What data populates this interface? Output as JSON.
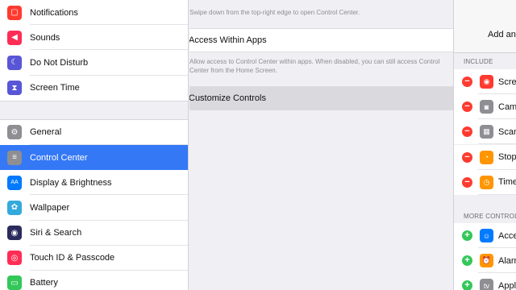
{
  "sidebar": {
    "group1": [
      {
        "label": "Notifications",
        "icon": "notifications-icon",
        "color": "#ff3b30",
        "glyph": "▢"
      },
      {
        "label": "Sounds",
        "icon": "speaker-icon",
        "color": "#ff2d55",
        "glyph": "◀"
      },
      {
        "label": "Do Not Disturb",
        "icon": "moon-icon",
        "color": "#5856d6",
        "glyph": "☾"
      },
      {
        "label": "Screen Time",
        "icon": "hourglass-icon",
        "color": "#5856d6",
        "glyph": "⧗"
      }
    ],
    "group2": [
      {
        "label": "General",
        "icon": "gear-icon",
        "color": "#8e8e93",
        "glyph": "⚙"
      },
      {
        "label": "Control Center",
        "icon": "toggles-icon",
        "color": "#8e8e93",
        "glyph": "≡",
        "selected": true
      },
      {
        "label": "Display & Brightness",
        "icon": "text-size-icon",
        "color": "#007aff",
        "glyph": "AA"
      },
      {
        "label": "Wallpaper",
        "icon": "flower-icon",
        "color": "#34aadc",
        "glyph": "✿"
      },
      {
        "label": "Siri & Search",
        "icon": "siri-icon",
        "color": "#2b2b5e",
        "glyph": "◉"
      },
      {
        "label": "Touch ID & Passcode",
        "icon": "fingerprint-icon",
        "color": "#ff2d55",
        "glyph": "◎"
      },
      {
        "label": "Battery",
        "icon": "battery-icon",
        "color": "#34c759",
        "glyph": "▭"
      }
    ]
  },
  "main": {
    "swipe_note": "Swipe down from the top-right edge to open Control Center.",
    "access_label": "Access Within Apps",
    "access_note": "Allow access to Control Center within apps. When disabled, you can still access Control Center from the Home Screen.",
    "customize_label": "Customize Controls"
  },
  "panel": {
    "title": "Add and Organize",
    "include_header": "INCLUDE",
    "more_header": "MORE CONTROLS",
    "include": [
      {
        "label": "Screen Recording",
        "icon": "record-icon",
        "color": "#ff3b30",
        "glyph": "◉"
      },
      {
        "label": "Camera",
        "icon": "camera-icon",
        "color": "#8e8e93",
        "glyph": "◙"
      },
      {
        "label": "Scan QR Code",
        "icon": "qr-code-icon",
        "color": "#8e8e93",
        "glyph": "▦"
      },
      {
        "label": "Stopwatch",
        "icon": "stopwatch-icon",
        "color": "#ff9500",
        "glyph": "◔"
      },
      {
        "label": "Timer",
        "icon": "timer-icon",
        "color": "#ff9500",
        "glyph": "◷"
      }
    ],
    "more": [
      {
        "label": "Accessibility Shortcuts",
        "icon": "accessibility-icon",
        "color": "#007aff",
        "glyph": "☺"
      },
      {
        "label": "Alarm",
        "icon": "alarm-icon",
        "color": "#ff9500",
        "glyph": "⏰"
      },
      {
        "label": "Apple TV Remote",
        "icon": "apple-tv-icon",
        "color": "#8e8e93",
        "glyph": "tv"
      }
    ]
  }
}
